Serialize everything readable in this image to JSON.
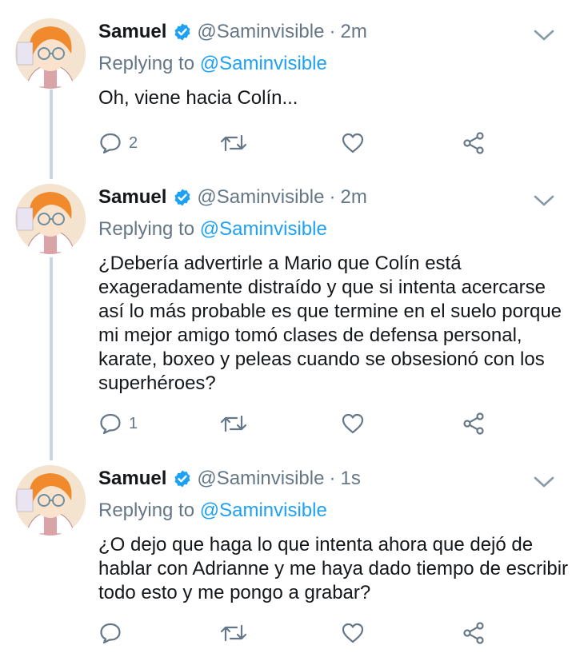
{
  "tweets": [
    {
      "name": "Samuel",
      "handle": "@Saminvisible",
      "time": "2m",
      "replying_prefix": "Replying to",
      "replying_to": "@Saminvisible",
      "text": "Oh, viene hacia Colín...",
      "reply_count": "2"
    },
    {
      "name": "Samuel",
      "handle": "@Saminvisible",
      "time": "2m",
      "replying_prefix": "Replying to",
      "replying_to": "@Saminvisible",
      "text": "¿Debería advertirle a Mario que Colín está exageradamente distraído y que si intenta acercarse así lo más probable es que termine en el suelo porque mi mejor amigo tomó clases de defensa personal, karate, boxeo y peleas cuando se obsesionó con los superhéroes?",
      "reply_count": "1"
    },
    {
      "name": "Samuel",
      "handle": "@Saminvisible",
      "time": "1s",
      "replying_prefix": "Replying to",
      "replying_to": "@Saminvisible",
      "text": "¿O dejo que haga lo que intenta ahora que dejó de hablar con Adrianne y me haya dado tiempo de escribir todo esto y me pongo a grabar?",
      "reply_count": ""
    }
  ],
  "icons": {
    "verified": "verified-badge-icon",
    "more": "chevron-down-icon",
    "reply": "reply-icon",
    "retweet": "retweet-icon",
    "like": "heart-icon",
    "share": "share-icon"
  },
  "colors": {
    "link": "#1da1f2",
    "secondary_text": "#657786",
    "thread_line": "#ccd6dd",
    "avatar_hair": "#f08a2c"
  }
}
